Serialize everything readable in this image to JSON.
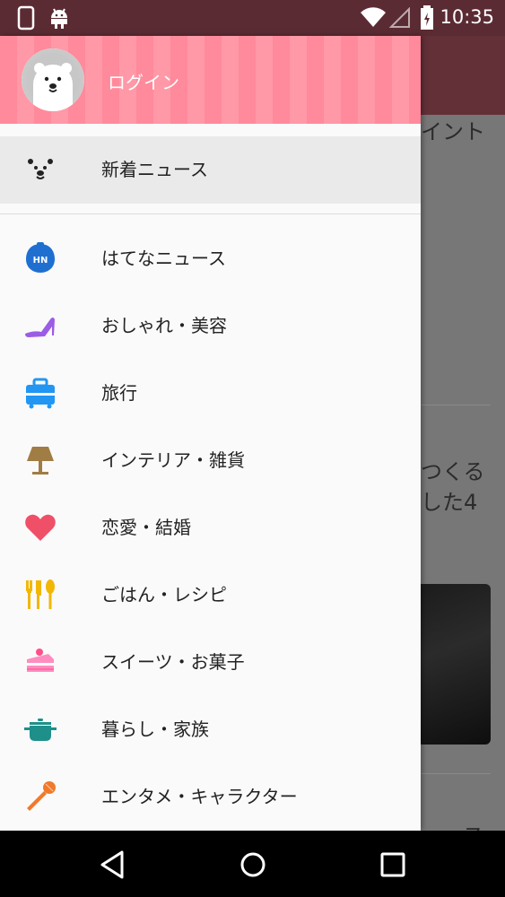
{
  "status_bar": {
    "time": "10:35",
    "icons": [
      "phone-icon",
      "android-icon",
      "wifi-icon",
      "signal-icon",
      "battery-icon"
    ]
  },
  "background_app": {
    "snippets": [
      "イント",
      "つくる",
      "した4",
      "ュース"
    ]
  },
  "drawer": {
    "login_label": "ログイン",
    "avatar": "polar-bear-avatar",
    "header_color": "#ff8a9b",
    "items": [
      {
        "label": "新着ニュース",
        "icon": "bear-face-icon",
        "selected": true
      },
      {
        "label": "はてなニュース",
        "icon": "hatena-news-icon",
        "selected": false
      },
      {
        "label": "おしゃれ・美容",
        "icon": "high-heel-icon",
        "selected": false
      },
      {
        "label": "旅行",
        "icon": "suitcase-icon",
        "selected": false
      },
      {
        "label": "インテリア・雑貨",
        "icon": "lamp-icon",
        "selected": false
      },
      {
        "label": "恋愛・結婚",
        "icon": "heart-icon",
        "selected": false
      },
      {
        "label": "ごはん・レシピ",
        "icon": "cutlery-icon",
        "selected": false
      },
      {
        "label": "スイーツ・お菓子",
        "icon": "cake-icon",
        "selected": false
      },
      {
        "label": "暮らし・家族",
        "icon": "pot-icon",
        "selected": false
      },
      {
        "label": "エンタメ・キャラクター",
        "icon": "microphone-icon",
        "selected": false
      }
    ],
    "hatena_badge": "HN"
  },
  "nav_bar": {
    "buttons": [
      "back-button",
      "home-button",
      "recents-button"
    ]
  }
}
